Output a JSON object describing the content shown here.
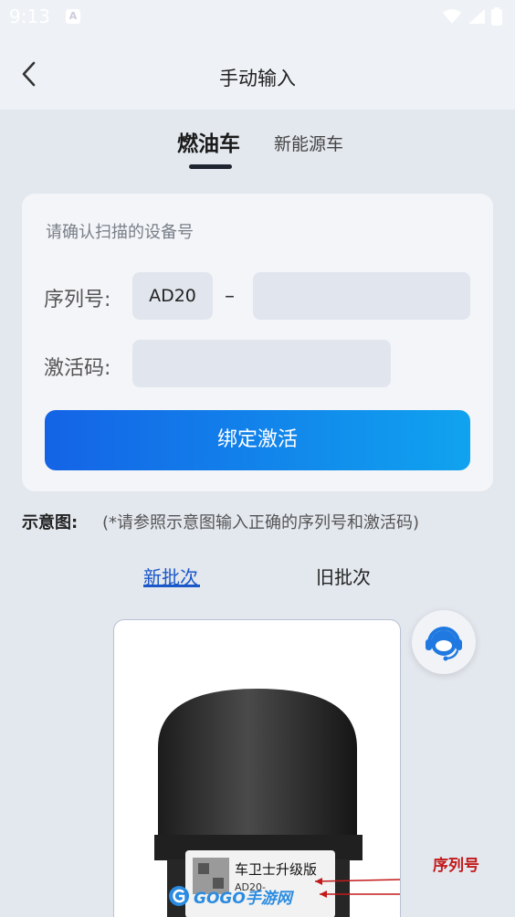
{
  "status_bar": {
    "time": "9:13",
    "notification_icon": "A"
  },
  "header": {
    "title": "手动输入",
    "back_icon": "chevron-left-icon"
  },
  "fuel_tabs": [
    {
      "label": "燃油车",
      "active": true
    },
    {
      "label": "新能源车",
      "active": false
    }
  ],
  "form": {
    "hint": "请确认扫描的设备号",
    "serial_label": "序列号:",
    "serial_prefix": "AD20",
    "separator": "–",
    "serial_value": "",
    "activation_label": "激活码:",
    "activation_value": "",
    "bind_button": "绑定激活"
  },
  "diagram": {
    "label": "示意图:",
    "note": "(*请参照示意图输入正确的序列号和激活码)",
    "batch_tabs": [
      {
        "label": "新批次",
        "active": true
      },
      {
        "label": "旧批次",
        "active": false
      }
    ],
    "device_label_title": "车卫士升级版",
    "device_label_serial": "AD20-",
    "annotation": "序列号"
  },
  "watermark": "GOGO手游网",
  "colors": {
    "accent": "#1a57c8",
    "button_gradient_start": "#1463e6",
    "button_gradient_end": "#10a3ef",
    "annotation_red": "#c21a1a"
  }
}
